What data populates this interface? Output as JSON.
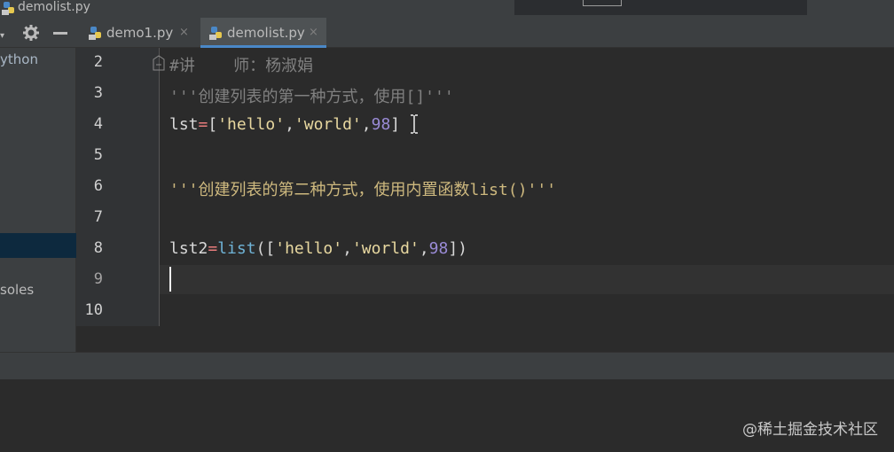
{
  "window": {
    "title": "demolist.py"
  },
  "toolbar": {
    "collapse_glyph": "▾"
  },
  "tabs": [
    {
      "label": "demo1.py",
      "close": "×",
      "active": false
    },
    {
      "label": "demolist.py",
      "close": "×",
      "active": true
    }
  ],
  "project": {
    "item_python": "ython",
    "item_consoles": "soles"
  },
  "editor": {
    "lines": [
      {
        "num": "2"
      },
      {
        "num": "3"
      },
      {
        "num": "4"
      },
      {
        "num": "5"
      },
      {
        "num": "6"
      },
      {
        "num": "7"
      },
      {
        "num": "8"
      },
      {
        "num": "9"
      },
      {
        "num": "10"
      }
    ],
    "code": {
      "l2": "#讲    师：杨淑娟",
      "l3": "'''创建列表的第一种方式，使用[]'''",
      "l4": {
        "a": "lst",
        "op": "=",
        "b": "[",
        "s1": "'hello'",
        "c1": ",",
        "s2": "'world'",
        "c2": ",",
        "n": "98",
        "e": "]"
      },
      "l6": "'''创建列表的第二种方式，使用内置函数list()'''",
      "l8": {
        "a": "lst2",
        "op": "=",
        "fn": "list",
        "b": "([",
        "s1": "'hello'",
        "c1": ",",
        "s2": "'world'",
        "c2": ",",
        "n": "98",
        "e": "])"
      }
    }
  },
  "watermark": "@稀土掘金技术社区",
  "colors": {
    "accent": "#4a88c7",
    "background": "#2b2b2b",
    "panel": "#3c3f41"
  }
}
